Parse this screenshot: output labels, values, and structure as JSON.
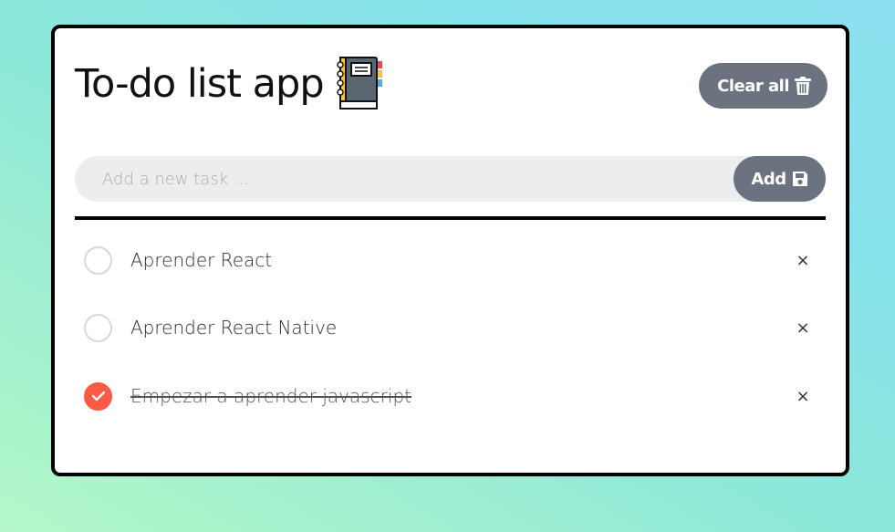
{
  "header": {
    "title": "To-do list app",
    "clear_label": "Clear all"
  },
  "new_task": {
    "placeholder": "Add a new task ...",
    "value": "",
    "add_label": "Add"
  },
  "tasks": [
    {
      "label": "Aprender React",
      "completed": false,
      "delete_glyph": "×"
    },
    {
      "label": "Aprender React Native",
      "completed": false,
      "delete_glyph": "×"
    },
    {
      "label": "Empezar a aprender javascript",
      "completed": true,
      "delete_glyph": "×"
    }
  ],
  "icons": {
    "logo": "notebook-icon",
    "clear": "trash-icon",
    "add": "floppy-disk-icon",
    "check": "checkmark-icon",
    "delete": "close-icon"
  },
  "colors": {
    "button": "#6b7280",
    "completed_check": "#fb5a47",
    "input_bg": "#ecedef"
  }
}
